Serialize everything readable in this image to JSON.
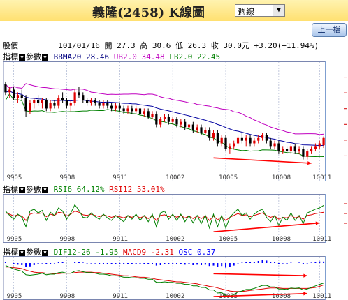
{
  "title": "義隆(2458)  K線圖",
  "period": {
    "selected": "週線"
  },
  "prev_button": "上一檔",
  "quote": {
    "label": "股價",
    "date": "101/01/16",
    "open_label": "開",
    "open": "27.3",
    "high_label": "高",
    "high": "30.6",
    "low_label": "低",
    "low": "26.3",
    "close_label": "收",
    "close": "30.0元",
    "change": "+3.20(+11.94%)"
  },
  "panel_controls": {
    "indicator": "指標",
    "params": "參數",
    "dropdown": "▼"
  },
  "main_legend": {
    "bb": "BBMA20 28.46",
    "ub": "UB2.0 34.48",
    "lb": "LB2.0 22.45"
  },
  "rsi_legend": {
    "rsi6": "RSI6 64.12%",
    "rsi12": "RSI12 53.01%"
  },
  "macd_legend": {
    "dif": "DIF12-26 -1.95",
    "macd": "MACD9 -2.31",
    "osc": "OSC 0.37"
  },
  "x_ticks": [
    "9905",
    "9908",
    "9911",
    "10002",
    "10005",
    "10008",
    "10011"
  ],
  "colors": {
    "ma": "#0000a0",
    "ub": "#c000c0",
    "lb": "#008000",
    "up": "#e00000",
    "down": "#000000",
    "annotation": "#ff0000",
    "osc": "#0000ff",
    "grid": "#9aa6c8"
  },
  "chart_data": [
    {
      "type": "line",
      "name": "price",
      "x_ticks": [
        "9905",
        "9908",
        "9911",
        "10002",
        "10005",
        "10008",
        "10011"
      ],
      "ylim": [
        18,
        58
      ],
      "candles": [
        [
          50,
          51,
          46,
          47
        ],
        [
          47,
          49,
          45,
          48
        ],
        [
          48,
          49,
          44,
          45
        ],
        [
          45,
          47,
          43,
          46
        ],
        [
          46,
          48,
          44,
          45
        ],
        [
          45,
          46,
          38,
          40
        ],
        [
          40,
          44,
          39,
          43
        ],
        [
          43,
          45,
          41,
          44
        ],
        [
          44,
          46,
          42,
          43
        ],
        [
          43,
          45,
          41,
          44
        ],
        [
          44,
          45,
          40,
          41
        ],
        [
          41,
          44,
          40,
          43
        ],
        [
          43,
          44,
          41,
          42
        ],
        [
          42,
          46,
          41,
          45
        ],
        [
          45,
          47,
          43,
          44
        ],
        [
          44,
          45,
          41,
          42
        ],
        [
          42,
          44,
          40,
          43
        ],
        [
          43,
          48,
          42,
          47
        ],
        [
          47,
          49,
          45,
          46
        ],
        [
          46,
          47,
          43,
          44
        ],
        [
          44,
          45,
          42,
          43
        ],
        [
          43,
          45,
          42,
          44
        ],
        [
          44,
          45,
          42,
          43
        ],
        [
          43,
          44,
          41,
          42
        ],
        [
          42,
          44,
          41,
          43
        ],
        [
          43,
          44,
          41,
          42
        ],
        [
          42,
          43,
          40,
          41
        ],
        [
          41,
          43,
          40,
          42
        ],
        [
          42,
          43,
          40,
          41
        ],
        [
          41,
          42,
          39,
          40
        ],
        [
          40,
          42,
          39,
          41
        ],
        [
          41,
          42,
          39,
          40
        ],
        [
          40,
          42,
          39,
          41
        ],
        [
          41,
          42,
          38,
          39
        ],
        [
          39,
          41,
          38,
          40
        ],
        [
          40,
          41,
          37,
          38
        ],
        [
          38,
          40,
          37,
          39
        ],
        [
          39,
          40,
          34,
          35
        ],
        [
          35,
          38,
          34,
          37
        ],
        [
          37,
          39,
          36,
          38
        ],
        [
          38,
          39,
          35,
          36
        ],
        [
          36,
          38,
          35,
          37
        ],
        [
          37,
          38,
          34,
          35
        ],
        [
          35,
          37,
          34,
          36
        ],
        [
          36,
          37,
          33,
          34
        ],
        [
          34,
          36,
          33,
          35
        ],
        [
          35,
          36,
          32,
          33
        ],
        [
          33,
          35,
          32,
          34
        ],
        [
          34,
          35,
          31,
          32
        ],
        [
          32,
          34,
          31,
          33
        ],
        [
          33,
          34,
          29,
          30
        ],
        [
          30,
          33,
          29,
          32
        ],
        [
          32,
          33,
          27,
          28
        ],
        [
          28,
          31,
          27,
          30
        ],
        [
          30,
          31,
          25,
          26
        ],
        [
          26,
          28,
          24,
          27
        ],
        [
          27,
          29,
          26,
          28
        ],
        [
          28,
          31,
          27,
          30
        ],
        [
          30,
          32,
          28,
          29
        ],
        [
          29,
          31,
          27,
          30
        ],
        [
          30,
          31,
          27,
          28
        ],
        [
          28,
          30,
          27,
          29
        ],
        [
          29,
          31,
          28,
          30
        ],
        [
          30,
          32,
          29,
          31
        ],
        [
          31,
          32,
          28,
          29
        ],
        [
          29,
          30,
          26,
          27
        ],
        [
          27,
          29,
          26,
          28
        ],
        [
          28,
          29,
          24,
          25
        ],
        [
          25,
          27,
          24,
          26
        ],
        [
          26,
          27,
          24,
          25
        ],
        [
          25,
          28,
          24,
          27
        ],
        [
          27,
          28,
          24,
          25
        ],
        [
          25,
          27,
          24,
          26
        ],
        [
          26,
          27,
          22,
          23
        ],
        [
          23,
          26,
          22,
          25
        ],
        [
          25,
          27,
          24,
          26
        ],
        [
          26,
          28,
          25,
          27
        ],
        [
          27,
          29,
          26,
          28
        ],
        [
          27.3,
          30.6,
          26.3,
          30.0
        ]
      ]
    },
    {
      "type": "line",
      "name": "RSI",
      "series": [
        {
          "name": "RSI6",
          "values": [
            55,
            48,
            42,
            50,
            45,
            30,
            55,
            58,
            52,
            56,
            40,
            53,
            48,
            60,
            55,
            42,
            52,
            65,
            56,
            45,
            44,
            52,
            46,
            42,
            50,
            44,
            40,
            48,
            43,
            38,
            48,
            42,
            50,
            40,
            48,
            38,
            50,
            30,
            52,
            55,
            42,
            50,
            40,
            50,
            38,
            48,
            36,
            48,
            35,
            48,
            28,
            50,
            30,
            48,
            28,
            45,
            52,
            58,
            48,
            52,
            42,
            50,
            55,
            58,
            45,
            38,
            48,
            32,
            45,
            40,
            52,
            40,
            48,
            35,
            52,
            55,
            58,
            60,
            64
          ]
        },
        {
          "name": "RSI12",
          "values": [
            52,
            50,
            47,
            49,
            47,
            40,
            50,
            52,
            51,
            52,
            46,
            50,
            48,
            53,
            52,
            47,
            50,
            55,
            53,
            49,
            48,
            50,
            48,
            46,
            49,
            47,
            45,
            47,
            46,
            44,
            47,
            45,
            48,
            44,
            47,
            43,
            47,
            40,
            48,
            49,
            46,
            48,
            45,
            48,
            44,
            47,
            43,
            47,
            43,
            47,
            40,
            47,
            41,
            46,
            40,
            45,
            48,
            51,
            48,
            49,
            46,
            48,
            50,
            52,
            48,
            45,
            47,
            42,
            45,
            44,
            48,
            44,
            46,
            42,
            48,
            49,
            51,
            52,
            53
          ]
        }
      ]
    },
    {
      "type": "line",
      "name": "MACD",
      "series": [
        {
          "name": "DIF12-26",
          "values": [
            1.5,
            1.2,
            0.8,
            0.6,
            0.4,
            -0.3,
            -0.4,
            -0.3,
            -0.2,
            0.0,
            -0.3,
            -0.2,
            -0.2,
            0.1,
            0.2,
            0.0,
            0.0,
            0.4,
            0.5,
            0.3,
            0.1,
            0.1,
            0.0,
            -0.2,
            -0.2,
            -0.3,
            -0.5,
            -0.5,
            -0.6,
            -0.8,
            -0.8,
            -0.9,
            -0.9,
            -1.0,
            -1.0,
            -1.2,
            -1.2,
            -1.8,
            -1.8,
            -1.7,
            -1.8,
            -1.8,
            -2.0,
            -2.0,
            -2.2,
            -2.2,
            -2.5,
            -2.5,
            -2.8,
            -2.8,
            -3.3,
            -3.3,
            -3.9,
            -3.8,
            -4.4,
            -4.5,
            -4.2,
            -3.7,
            -3.5,
            -3.2,
            -3.2,
            -3.0,
            -2.7,
            -2.4,
            -2.4,
            -2.7,
            -2.7,
            -3.1,
            -3.1,
            -3.2,
            -2.9,
            -3.0,
            -2.9,
            -3.3,
            -3.1,
            -2.8,
            -2.5,
            -2.2,
            -1.95
          ]
        },
        {
          "name": "MACD9",
          "values": [
            1.2,
            1.2,
            1.1,
            1.0,
            0.9,
            0.6,
            0.4,
            0.2,
            0.1,
            0.1,
            0.0,
            0.0,
            -0.1,
            -0.1,
            0.0,
            0.0,
            0.0,
            0.1,
            0.2,
            0.2,
            0.2,
            0.2,
            0.1,
            0.1,
            0.0,
            -0.1,
            -0.2,
            -0.3,
            -0.4,
            -0.5,
            -0.5,
            -0.6,
            -0.7,
            -0.8,
            -0.8,
            -0.9,
            -1.0,
            -1.2,
            -1.3,
            -1.4,
            -1.5,
            -1.6,
            -1.7,
            -1.7,
            -1.8,
            -1.9,
            -2.0,
            -2.1,
            -2.3,
            -2.4,
            -2.6,
            -2.7,
            -2.9,
            -3.1,
            -3.3,
            -3.5,
            -3.6,
            -3.6,
            -3.6,
            -3.5,
            -3.4,
            -3.3,
            -3.2,
            -3.1,
            -3.0,
            -2.9,
            -2.9,
            -2.9,
            -3.0,
            -3.0,
            -3.0,
            -3.0,
            -3.0,
            -3.0,
            -3.0,
            -2.9,
            -2.8,
            -2.6,
            -2.31
          ]
        }
      ]
    }
  ]
}
